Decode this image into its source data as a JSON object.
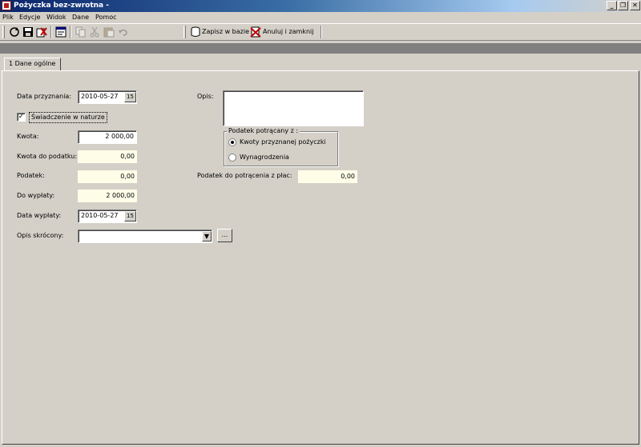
{
  "window": {
    "title": "Pożyczka bez-zwrotna -",
    "controls": {
      "minimize": "_",
      "restore": "❐",
      "close": "✕"
    }
  },
  "menu": [
    "Plik",
    "Edycje",
    "Widok",
    "Dane",
    "Pomoc"
  ],
  "toolbar": {
    "icons": [
      "refresh-icon",
      "save-icon",
      "delete-icon",
      "properties-icon",
      "copy-icon",
      "cut-icon",
      "paste-icon",
      "undo-icon"
    ],
    "save_to_db_label": "Zapisz w bazie",
    "cancel_close_label": "Anuluj i zamknij"
  },
  "tab": {
    "label": "1 Dane ogólne"
  },
  "form": {
    "data_przyznania": {
      "label": "Data przyznania:",
      "value": "2010-05-27"
    },
    "swiadczenie": {
      "label": "Świadczenie w naturze",
      "checked": true
    },
    "kwota": {
      "label": "Kwota:",
      "value": "2 000,00"
    },
    "kwota_do_podatku": {
      "label": "Kwota do podatku:",
      "value": "0,00"
    },
    "podatek": {
      "label": "Podatek:",
      "value": "0,00"
    },
    "do_wyplaty": {
      "label": "Do wypłaty:",
      "value": "2 000,00"
    },
    "data_wyplaty": {
      "label": "Data wypłaty:",
      "value": "2010-05-27"
    },
    "opis_skrocony": {
      "label": "Opis skrócony:",
      "value": ""
    },
    "opis": {
      "label": "Opis:",
      "value": ""
    },
    "podatek_potracany": {
      "legend": "Podatek potrącany z :",
      "options": [
        "Kwoty przyznanej pożyczki",
        "Wynagrodzenia"
      ],
      "selected": "Kwoty przyznanej pożyczki"
    },
    "podatek_do_potracenia": {
      "label": "Podatek do potrącenia z płac:",
      "value": "0,00"
    },
    "calendar_glyph": "15",
    "ellipsis": "..."
  }
}
